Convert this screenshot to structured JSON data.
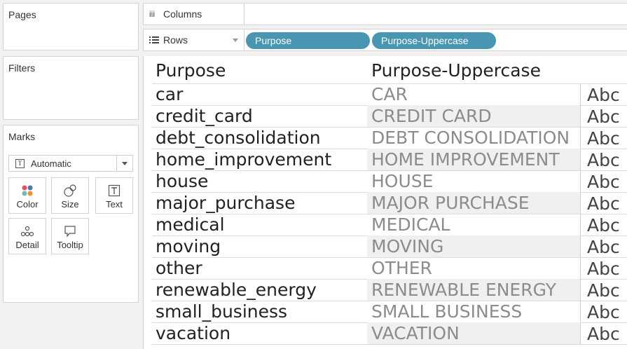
{
  "cards": {
    "pages_title": "Pages",
    "filters_title": "Filters",
    "marks_title": "Marks"
  },
  "marks": {
    "mark_type": "Automatic",
    "buttons": {
      "color": "Color",
      "size": "Size",
      "text": "Text",
      "detail": "Detail",
      "tooltip": "Tooltip"
    }
  },
  "shelves": {
    "columns_label": "Columns",
    "rows_label": "Rows",
    "row_pills": [
      "Purpose",
      "Purpose-Uppercase"
    ]
  },
  "table": {
    "headers": [
      "Purpose",
      "Purpose-Uppercase"
    ],
    "rows": [
      {
        "purpose": "car",
        "upper": "CAR",
        "abc": "Abc"
      },
      {
        "purpose": "credit_card",
        "upper": "CREDIT CARD",
        "abc": "Abc"
      },
      {
        "purpose": "debt_consolidation",
        "upper": "DEBT CONSOLIDATION",
        "abc": "Abc"
      },
      {
        "purpose": "home_improvement",
        "upper": "HOME IMPROVEMENT",
        "abc": "Abc"
      },
      {
        "purpose": "house",
        "upper": "HOUSE",
        "abc": "Abc"
      },
      {
        "purpose": "major_purchase",
        "upper": "MAJOR PURCHASE",
        "abc": "Abc"
      },
      {
        "purpose": "medical",
        "upper": "MEDICAL",
        "abc": "Abc"
      },
      {
        "purpose": "moving",
        "upper": "MOVING",
        "abc": "Abc"
      },
      {
        "purpose": "other",
        "upper": "OTHER",
        "abc": "Abc"
      },
      {
        "purpose": "renewable_energy",
        "upper": "RENEWABLE ENERGY",
        "abc": "Abc"
      },
      {
        "purpose": "small_business",
        "upper": "SMALL BUSINESS",
        "abc": "Abc"
      },
      {
        "purpose": "vacation",
        "upper": "VACATION",
        "abc": "Abc"
      }
    ]
  },
  "colors": {
    "pill": "#4996b2",
    "band": "#f0f0f0"
  }
}
